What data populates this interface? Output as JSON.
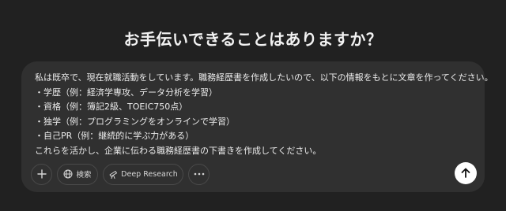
{
  "heading": "お手伝いできることはありますか？",
  "composer": {
    "lines": [
      "私は既卒で、現在就職活動をしています。職務経歴書を作成したいので、以下の情報をもとに文章を作ってください。",
      "・学歴（例：経済学専攻、データ分析を学習）",
      "・資格（例：簿記2級、TOEIC750点）",
      "・独学（例：プログラミングをオンラインで学習）",
      "・自己PR（例：継続的に学ぶ力がある）",
      "これらを活かし、企業に伝わる職務経歴書の下書きを作成してください。"
    ]
  },
  "toolbar": {
    "add_icon": "plus-icon",
    "search_icon": "globe-icon",
    "search_label": "検索",
    "research_icon": "telescope-icon",
    "research_label": "Deep Research",
    "more_icon": "ellipsis-icon"
  },
  "send": {
    "icon": "arrow-up-icon"
  },
  "colors": {
    "background": "#212121",
    "composer": "#303030",
    "send_button": "#ffffff"
  }
}
